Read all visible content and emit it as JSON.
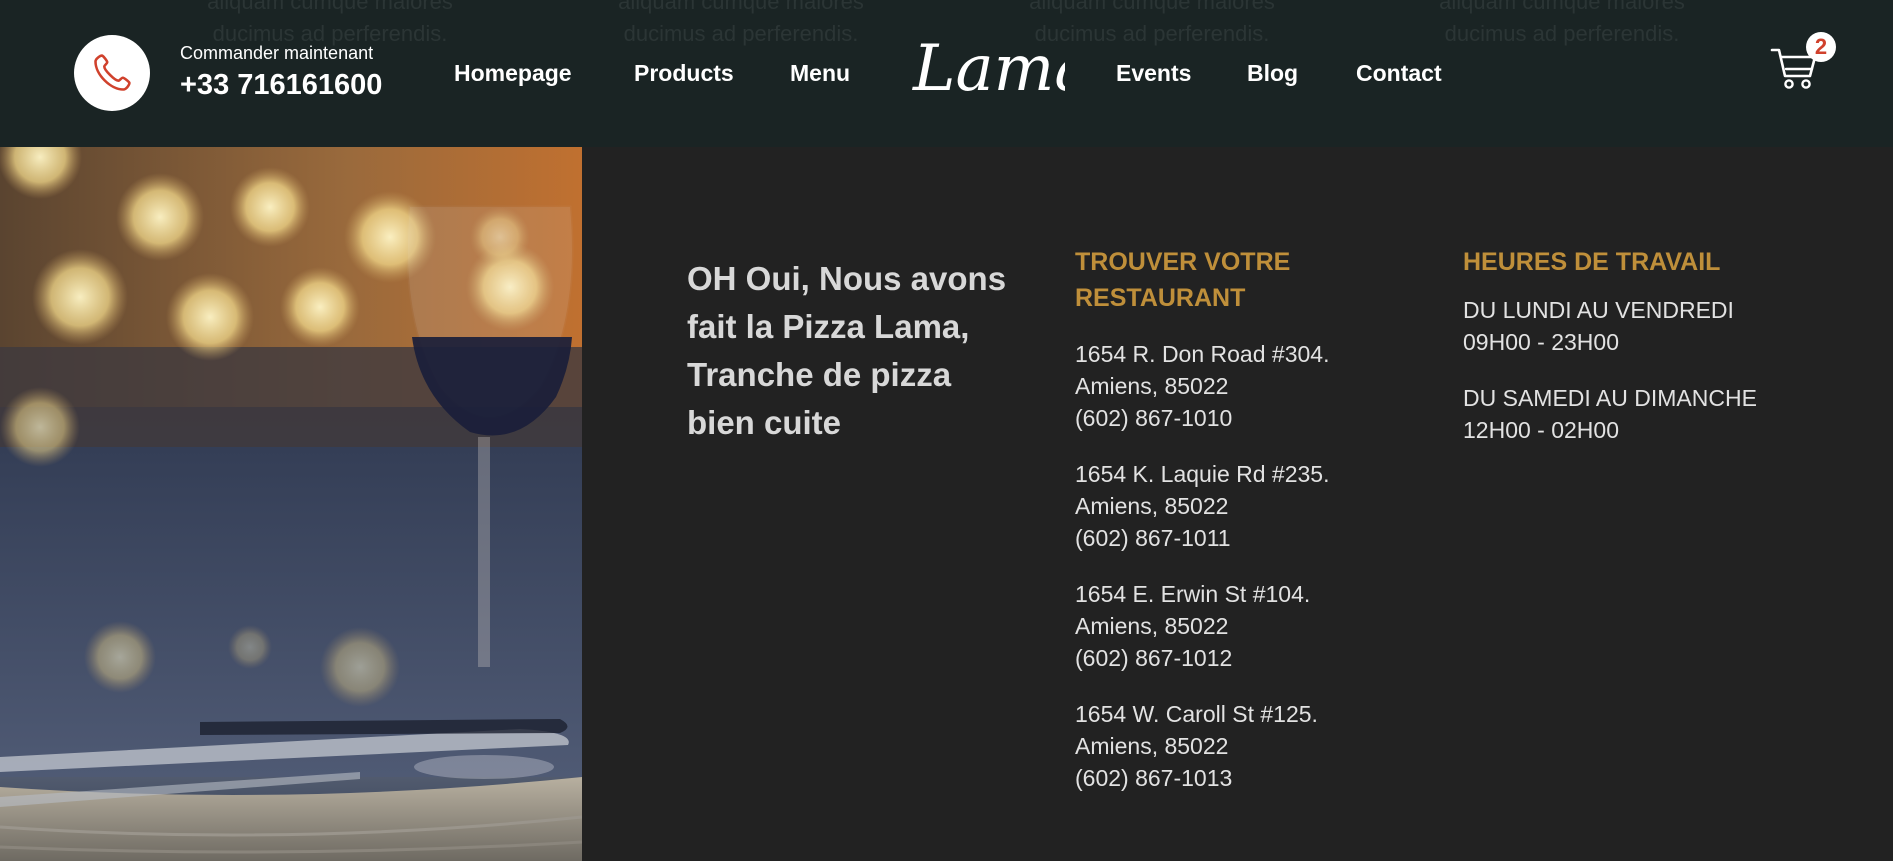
{
  "header": {
    "background_text": [
      "aliquam cumque maiores ducimus ad perferendis.",
      "aliquam cumque maiores ducimus ad perferendis.",
      "aliquam cumque maiores ducimus ad perferendis.",
      "aliquam cumque maiores ducimus ad perferendis."
    ],
    "order_caption": "Commander maintenant",
    "phone_number": "+33 716161600",
    "nav_left": [
      "Homepage",
      "Products",
      "Menu"
    ],
    "logo_text": "Lama",
    "nav_right": [
      "Events",
      "Blog",
      "Contact"
    ],
    "cart_count": "2",
    "colors": {
      "navbar_bg": "#1a2424",
      "phone_icon": "#d0412c",
      "badge_text": "#d0412c"
    },
    "icons": {
      "phone": "phone-icon",
      "cart": "cart-icon"
    }
  },
  "info": {
    "slogan": "OH Oui, Nous avons fait la Pizza Lama, Tranche de pizza bien cuite",
    "find_title": "TROUVER VOTRE RESTAURANT",
    "restaurants": [
      {
        "street": "1654 R. Don Road #304.",
        "city": "Amiens, 85022",
        "phone": "(602) 867-1010"
      },
      {
        "street": "1654 K. Laquie Rd #235.",
        "city": "Amiens, 85022",
        "phone": "(602) 867-1011"
      },
      {
        "street": "1654 E. Erwin St #104.",
        "city": "Amiens, 85022",
        "phone": "(602) 867-1012"
      },
      {
        "street": "1654 W. Caroll St #125.",
        "city": "Amiens, 85022",
        "phone": "(602) 867-1013"
      }
    ],
    "hours_title": "HEURES DE TRAVAIL",
    "hours": [
      {
        "days": "DU LUNDI AU VENDREDI",
        "time": "09H00 - 23H00"
      },
      {
        "days": "DU SAMEDI AU DIMANCHE",
        "time": "12H00 - 02H00"
      }
    ],
    "colors": {
      "heading": "#bf8f3a",
      "panel_bg": "#222222"
    }
  }
}
